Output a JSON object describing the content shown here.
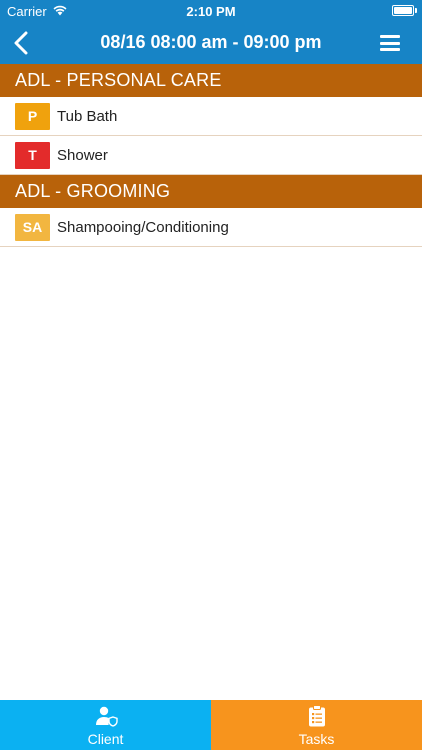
{
  "status_bar": {
    "carrier": "Carrier",
    "time": "2:10 PM",
    "wifi_icon": "wifi-icon",
    "battery_icon": "battery-icon"
  },
  "nav": {
    "title": "08/16 08:00 am - 09:00 pm",
    "back_icon": "chevron-left-icon",
    "menu_icon": "hamburger-menu-icon"
  },
  "colors": {
    "nav_bg": "#1784c6",
    "section_bg": "#b8620a",
    "badge_p": "#f0a20d",
    "badge_t": "#e32b2b",
    "badge_sa": "#f2b640",
    "tab_client": "#0bb1f2",
    "tab_tasks": "#f7941d"
  },
  "sections": [
    {
      "title": "ADL - PERSONAL CARE",
      "items": [
        {
          "badge": "P",
          "label": "Tub Bath"
        },
        {
          "badge": "T",
          "label": "Shower"
        }
      ]
    },
    {
      "title": "ADL - GROOMING",
      "items": [
        {
          "badge": "SA",
          "label": "Shampooing/Conditioning"
        }
      ]
    }
  ],
  "tabs": {
    "client": {
      "label": "Client",
      "icon": "user-shield-icon"
    },
    "tasks": {
      "label": "Tasks",
      "icon": "clipboard-list-icon"
    }
  }
}
